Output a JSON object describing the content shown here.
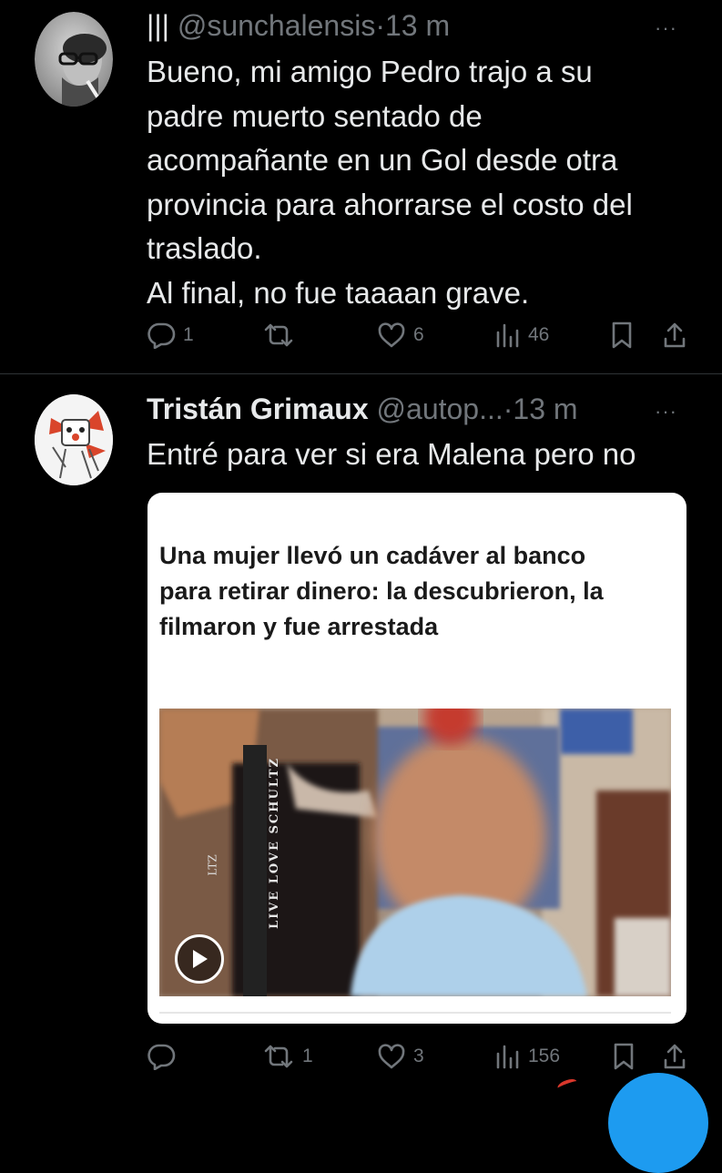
{
  "tweets": [
    {
      "handle_prefix": "|||",
      "handle": "@sunchalensis",
      "separator": "·",
      "time": "13 m",
      "more": "···",
      "lines": [
        "Bueno, mi amigo Pedro trajo a su",
        "padre muerto sentado de",
        "acompañante en un Gol desde otra",
        "provincia para ahorrarse el costo del",
        "traslado.",
        "Al final, no fue taaaan grave."
      ],
      "actions": {
        "replies": "1",
        "retweets": "",
        "likes": "6",
        "views": "46"
      }
    },
    {
      "name": "Tristán Grimaux",
      "handle": "@autop...",
      "separator": "·",
      "time": "13 m",
      "more": "···",
      "lines": [
        "Entré para ver si era Malena pero no"
      ],
      "card": {
        "title_lines": [
          "Una mujer llevó un cadáver al banco",
          "para retirar dinero: la descubrieron, la",
          "filmaron y fue arrestada"
        ],
        "video_texts": [
          "LIVE LOVE SCHULTZ",
          "LTZ"
        ]
      },
      "actions": {
        "replies": "",
        "retweets": "1",
        "likes": "3",
        "views": "156"
      }
    }
  ],
  "icons": {
    "reply": "reply-icon",
    "retweet": "retweet-icon",
    "like": "heart-icon",
    "views": "views-icon",
    "bookmark": "bookmark-icon",
    "share": "share-icon",
    "play": "play-icon"
  },
  "colors": {
    "background": "#000000",
    "text": "#e7e9ea",
    "secondary": "#71767b",
    "divider": "#2f3336",
    "card": "#ffffff",
    "card_title": "#1a1a1a"
  }
}
